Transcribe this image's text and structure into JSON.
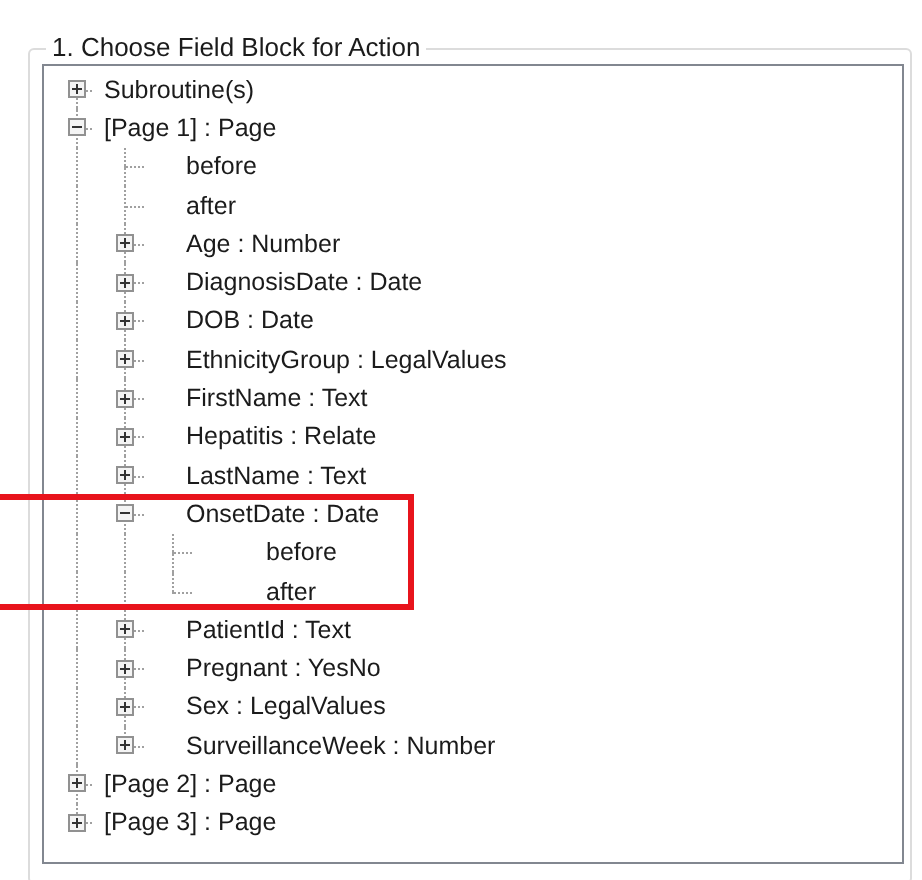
{
  "group_box": {
    "title": "1. Choose Field Block for Action"
  },
  "tree": [
    {
      "label": "Subroutine(s)",
      "expanded": false
    },
    {
      "label": "[Page 1] : Page",
      "expanded": true,
      "children": [
        {
          "label": "before"
        },
        {
          "label": "after"
        },
        {
          "label": "Age : Number",
          "expanded": false
        },
        {
          "label": "DiagnosisDate : Date",
          "expanded": false
        },
        {
          "label": "DOB : Date",
          "expanded": false
        },
        {
          "label": "EthnicityGroup : LegalValues",
          "expanded": false
        },
        {
          "label": "FirstName : Text",
          "expanded": false
        },
        {
          "label": "Hepatitis : Relate",
          "expanded": false
        },
        {
          "label": "LastName : Text",
          "expanded": false
        },
        {
          "label": "OnsetDate : Date",
          "expanded": true,
          "highlighted": true,
          "children": [
            {
              "label": "before"
            },
            {
              "label": "after"
            }
          ]
        },
        {
          "label": "PatientId : Text",
          "expanded": false
        },
        {
          "label": "Pregnant : YesNo",
          "expanded": false
        },
        {
          "label": "Sex : LegalValues",
          "expanded": false
        },
        {
          "label": "SurveillanceWeek : Number",
          "expanded": false
        }
      ]
    },
    {
      "label": "[Page 2] : Page",
      "expanded": false
    },
    {
      "label": "[Page 3] : Page",
      "expanded": false
    }
  ]
}
